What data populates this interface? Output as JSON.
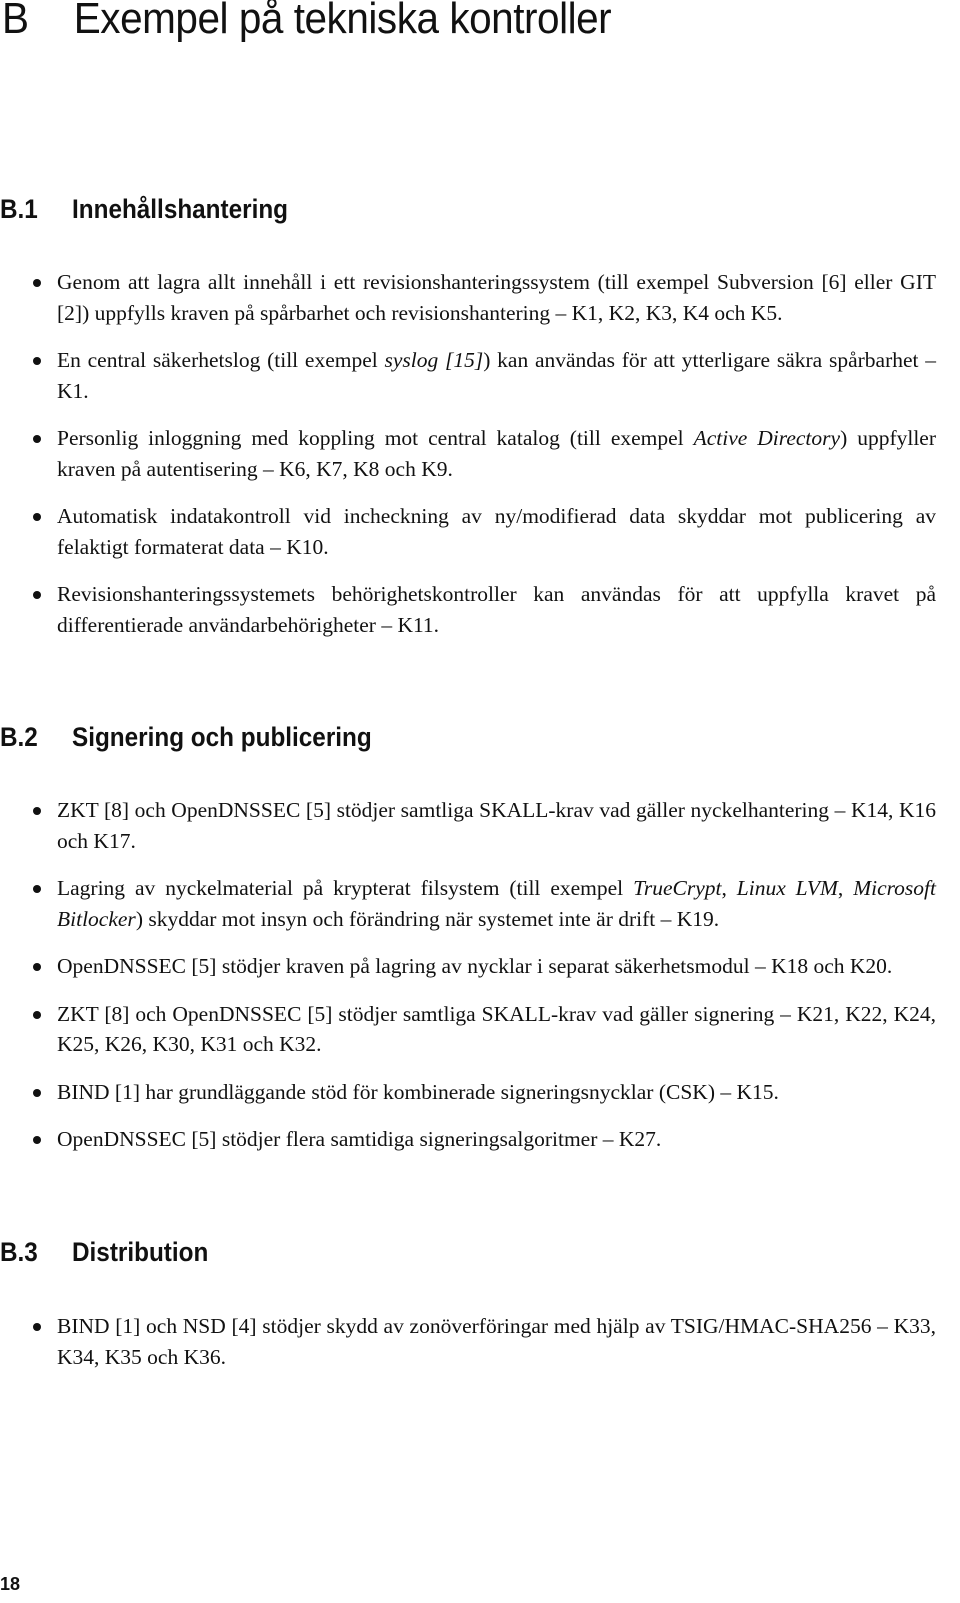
{
  "chapter": {
    "number": "B",
    "title": "Exempel på tekniska kontroller"
  },
  "sections": [
    {
      "number": "B.1",
      "title": "Innehållshantering",
      "items": [
        [
          {
            "t": "Genom att lagra allt innehåll i ett revisionshanteringssystem (till exempel Subversion [6] eller GIT [2]) uppfylls kraven på spårbarhet och revisionshantering – K1, K2, K3, K4 och K5."
          }
        ],
        [
          {
            "t": "En central säkerhetslog (till exempel "
          },
          {
            "t": "syslog [15]",
            "i": true
          },
          {
            "t": ") kan användas för att ytterligare säkra spårbarhet – K1."
          }
        ],
        [
          {
            "t": "Personlig inloggning med koppling mot central katalog (till exempel "
          },
          {
            "t": "Active Directory",
            "i": true
          },
          {
            "t": ") uppfyller kraven på autentisering – K6, K7, K8 och K9."
          }
        ],
        [
          {
            "t": "Automatisk indatakontroll vid incheckning av ny/modifierad data skyddar mot publicering av felaktigt formaterat data – K10."
          }
        ],
        [
          {
            "t": "Revisionshanteringssystemets behörighetskontroller kan användas för att uppfylla kravet på differentierade användarbehörigheter – K11."
          }
        ]
      ]
    },
    {
      "number": "B.2",
      "title": "Signering och publicering",
      "items": [
        [
          {
            "t": "ZKT [8] och OpenDNSSEC [5] stödjer samtliga SKALL-krav vad gäller nyckelhantering – K14, K16 och K17."
          }
        ],
        [
          {
            "t": "Lagring av nyckelmaterial på krypterat filsystem (till exempel "
          },
          {
            "t": "TrueCrypt",
            "i": true
          },
          {
            "t": ", "
          },
          {
            "t": "Linux LVM",
            "i": true
          },
          {
            "t": ", "
          },
          {
            "t": "Microsoft Bitlocker",
            "i": true
          },
          {
            "t": ") skyddar mot insyn och förändring när systemet inte är drift – K19."
          }
        ],
        [
          {
            "t": "OpenDNSSEC [5] stödjer kraven på lagring av nycklar i separat säkerhetsmodul – K18 och K20."
          }
        ],
        [
          {
            "t": "ZKT [8] och OpenDNSSEC [5] stödjer samtliga SKALL-krav vad gäller signering – K21, K22, K24, K25, K26, K30, K31 och K32."
          }
        ],
        [
          {
            "t": "BIND [1] har grundläggande stöd för kombinerade signeringsnycklar (CSK) – K15."
          }
        ],
        [
          {
            "t": "OpenDNSSEC [5] stödjer flera samtidiga signeringsalgoritmer – K27."
          }
        ]
      ]
    },
    {
      "number": "B.3",
      "title": "Distribution",
      "items": [
        [
          {
            "t": "BIND [1] och NSD [4] stödjer skydd av zonöverföringar med hjälp av TSIG/HMAC-SHA256 – K33, K34, K35 och K36."
          }
        ]
      ]
    }
  ],
  "page_number": "18"
}
